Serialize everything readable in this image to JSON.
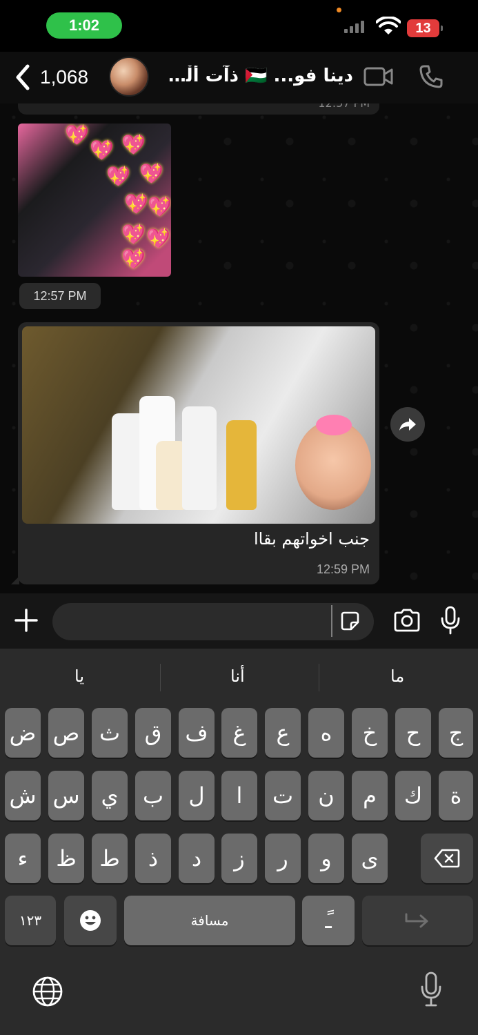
{
  "status": {
    "time": "1:02",
    "battery": "13"
  },
  "header": {
    "back_count": "1,068",
    "title": "دينا فو... 🇵🇸 ذآت ألْخِمآَرْ."
  },
  "messages": {
    "prev_time": "12:57 PM",
    "image1_time": "12:57 PM",
    "caption": "جنب اخواتهم بقاا",
    "caption_time": "12:59 PM"
  },
  "composer": {
    "placeholder": ""
  },
  "keyboard": {
    "suggestions": [
      "يا",
      "أنا",
      "ما"
    ],
    "row1": [
      "ض",
      "ص",
      "ث",
      "ق",
      "ف",
      "غ",
      "ع",
      "ه",
      "خ",
      "ح",
      "ج"
    ],
    "row2": [
      "ش",
      "س",
      "ي",
      "ب",
      "ل",
      "ا",
      "ت",
      "ن",
      "م",
      "ك",
      "ة"
    ],
    "row3": [
      "ء",
      "ظ",
      "ط",
      "ذ",
      "د",
      "ز",
      "ر",
      "و",
      "ى"
    ],
    "numbers_label": "١٢٣",
    "space_label": "مسافة",
    "diacritic_label": "ًـ"
  },
  "colors": {
    "status_green": "#2fc14a",
    "battery_red": "#e23b3b",
    "bubble": "#262626"
  }
}
